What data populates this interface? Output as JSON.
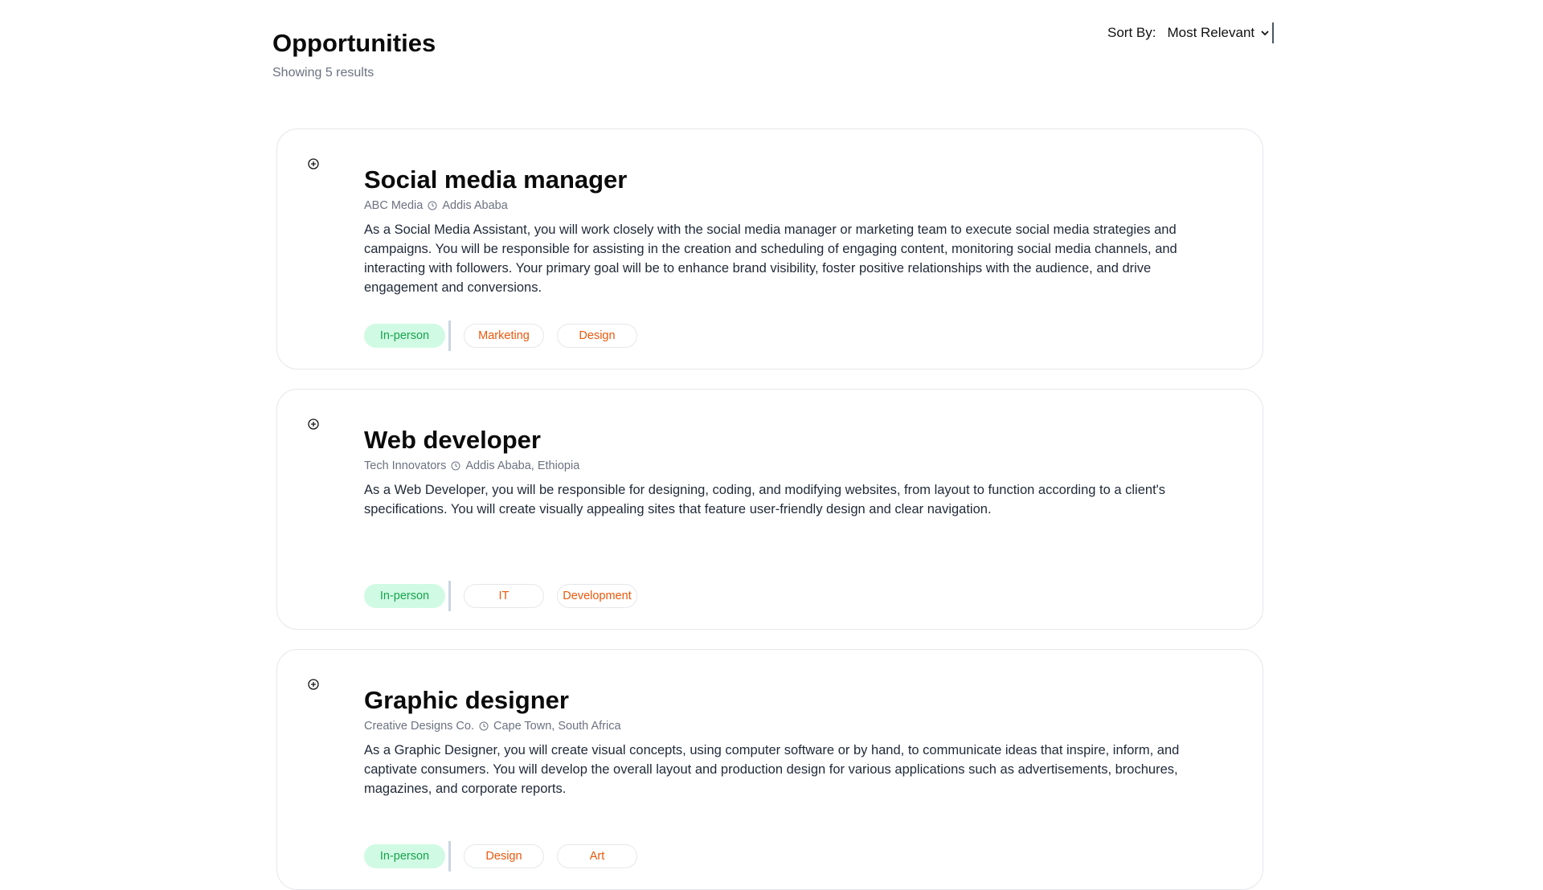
{
  "header": {
    "title": "Opportunities",
    "result_count": "Showing 5 results"
  },
  "sort": {
    "label": "Sort By:",
    "selected": "Most Relevant"
  },
  "jobs": [
    {
      "title": "Social media manager",
      "company": "ABC Media",
      "location": "Addis Ababa",
      "description": "As a Social Media Assistant, you will work closely with the social media manager or marketing team to execute social media strategies and campaigns. You will be responsible for assisting in the creation and scheduling of engaging content, monitoring social media channels, and interacting with followers. Your primary goal will be to enhance brand visibility, foster positive relationships with the audience, and drive engagement and conversions.",
      "type": "In-person",
      "categories": [
        "Marketing",
        "Design"
      ]
    },
    {
      "title": "Web developer",
      "company": "Tech Innovators",
      "location": "Addis Ababa, Ethiopia",
      "description": "As a Web Developer, you will be responsible for designing, coding, and modifying websites, from layout to function according to a client's specifications. You will create visually appealing sites that feature user-friendly design and clear navigation.",
      "type": "In-person",
      "categories": [
        "IT",
        "Development"
      ]
    },
    {
      "title": "Graphic designer",
      "company": "Creative Designs Co.",
      "location": "Cape Town, South Africa",
      "description": "As a Graphic Designer, you will create visual concepts, using computer software or by hand, to communicate ideas that inspire, inform, and captivate consumers. You will develop the overall layout and production design for various applications such as advertisements, brochures, magazines, and corporate reports.",
      "type": "In-person",
      "categories": [
        "Design",
        "Art"
      ]
    }
  ],
  "icons": {
    "card_icon": "plus-circle-icon",
    "location_icon": "location-clock-icon",
    "sort_icon": "chevron-down-icon"
  },
  "colors": {
    "type_tag_bg": "#d1fae5",
    "type_tag_text": "#16a34a",
    "category_tag_text": "#ea580c"
  }
}
